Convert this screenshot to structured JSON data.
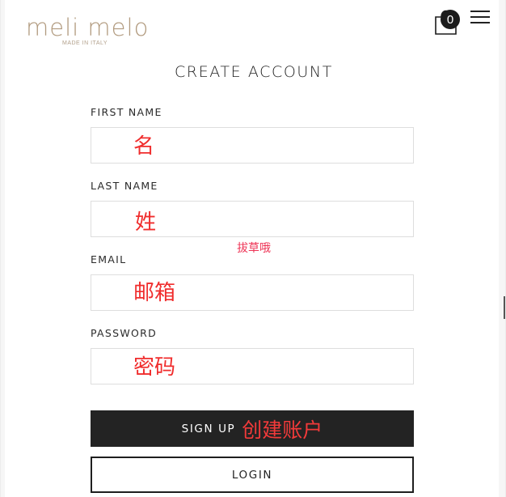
{
  "header": {
    "logo_main": "meli melo",
    "logo_sub": "MADE IN ITALY",
    "cart_count": "0"
  },
  "title": "CREATE ACCOUNT",
  "form": {
    "first_name": {
      "label": "FIRST NAME",
      "value": "",
      "annotation": "名"
    },
    "last_name": {
      "label": "LAST NAME",
      "value": "",
      "annotation": "姓"
    },
    "email": {
      "label": "EMAIL",
      "value": "",
      "annotation": "邮箱"
    },
    "password": {
      "label": "PASSWORD",
      "value": "",
      "annotation": "密码"
    }
  },
  "floating_annotation": "拔草哦",
  "buttons": {
    "signup_label": "SIGN UP",
    "signup_annotation": "创建账户",
    "login_label": "LOGIN"
  },
  "colors": {
    "brand": "#b19a7e",
    "annotation": "#f02d2d",
    "button_dark": "#232323"
  },
  "icons": [
    "shopping-bag-icon",
    "hamburger-menu-icon"
  ]
}
